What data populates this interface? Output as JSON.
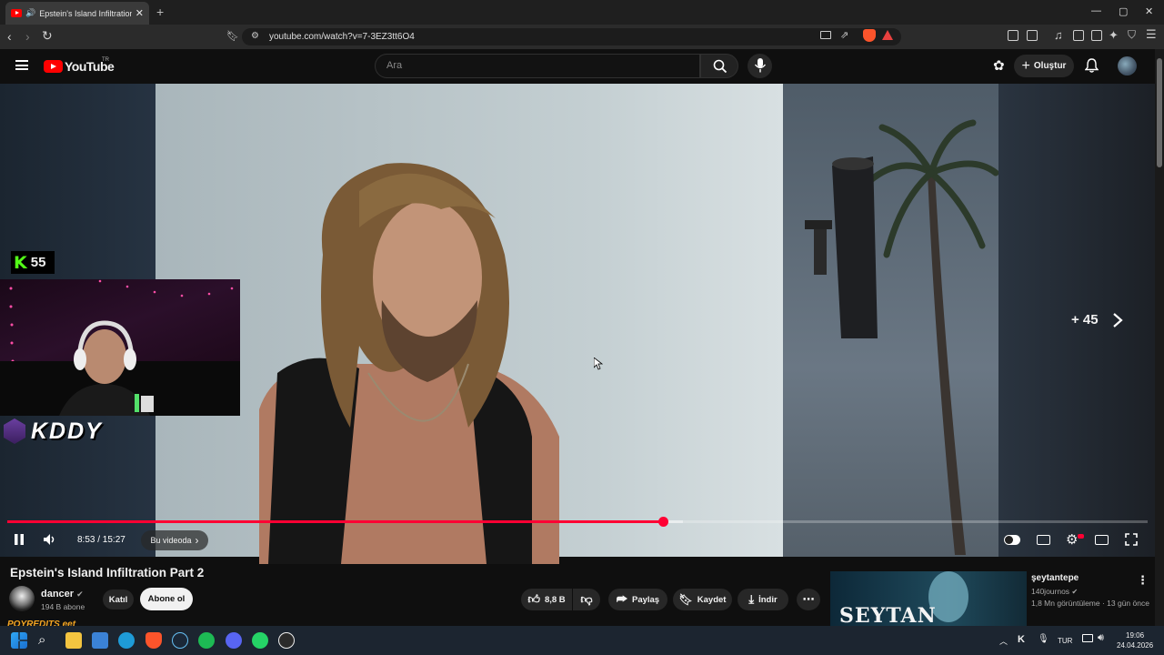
{
  "browser": {
    "tab_title": "Epstein's Island Infiltration Pa",
    "new_tab": "+",
    "url": "youtube.com/watch?v=7-3EZ3tt6O4",
    "window_controls": [
      "—",
      "▢",
      "✕"
    ]
  },
  "youtube": {
    "logo_text": "YouTube",
    "country": "TR",
    "search_placeholder": "Ara",
    "create_label": "Oluştur"
  },
  "overlay": {
    "kick_count": "55",
    "streamer_name": "KDDY",
    "skip_label": "+ 45"
  },
  "player": {
    "current_time": "8:53",
    "duration": "15:27",
    "time_display": "8:53 / 15:27",
    "progress_fraction": 0.575,
    "chapter_label": "Bu videoda",
    "accent_color": "#ff0033"
  },
  "video": {
    "title": "Epstein's Island Infiltration Part 2",
    "channel_name": "dancer",
    "subscribers": "194 B abone",
    "join_label": "Katıl",
    "subscribe_label": "Abone ol",
    "like_count": "8,8 B",
    "share_label": "Paylaş",
    "save_label": "Kaydet",
    "download_label": "İndir"
  },
  "recommendation": {
    "thumb_text": "SEYTAN",
    "title": "şeytantepe",
    "channel": "140journos",
    "meta": "1,8 Mn görüntüleme · 13 gün önce"
  },
  "watermark": "POYREDITS eet",
  "taskbar": {
    "lang": "TUR",
    "time": "19:06",
    "date": "24.04.2026"
  }
}
